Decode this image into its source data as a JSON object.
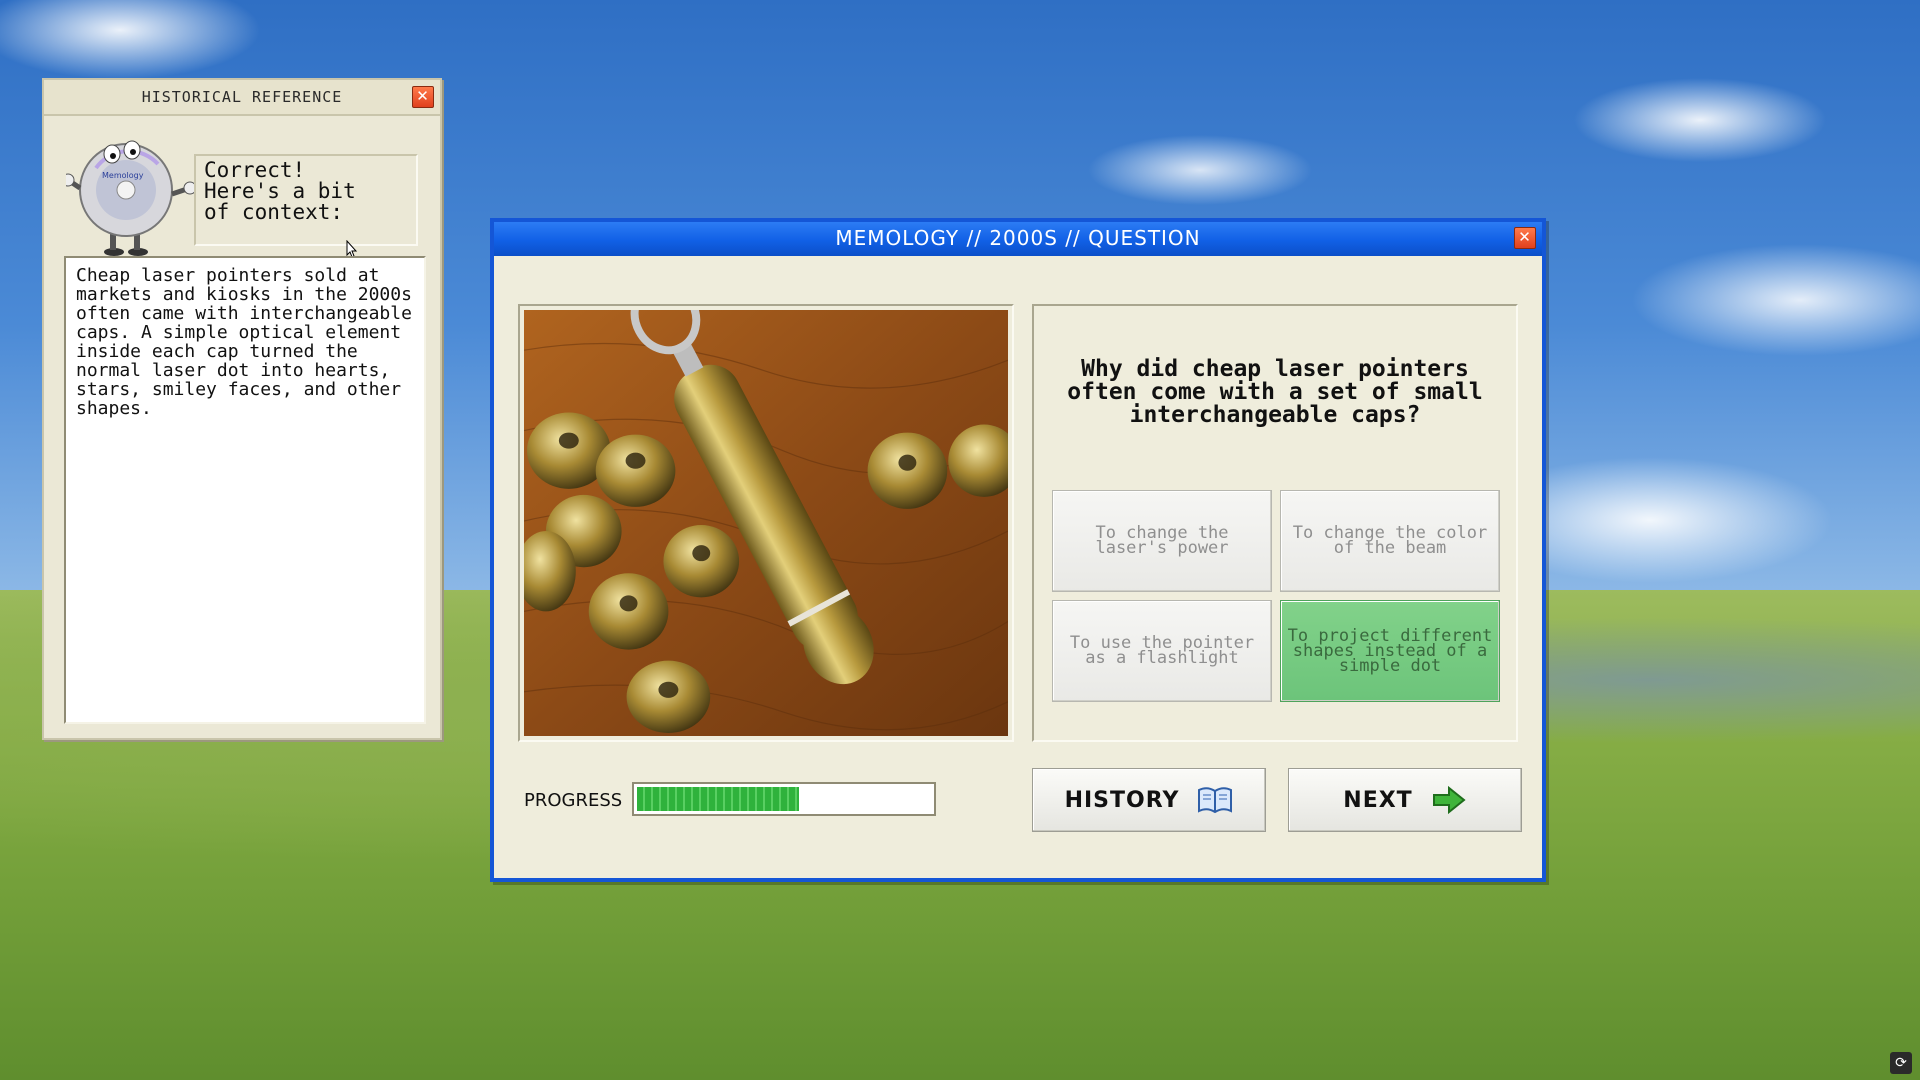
{
  "reference_window": {
    "title": "HISTORICAL REFERENCE",
    "speech": "Correct!\nHere's a bit\nof context:",
    "context_text": "Cheap laser pointers sold at markets and kiosks in the 2000s often came with interchangeable caps. A simple optical element inside each cap turned the normal laser dot into hearts, stars, smiley faces, and other shapes.",
    "mascot_icon": "cd-mascot-icon",
    "mascot_disc_label": "Memology"
  },
  "quiz_window": {
    "title": "MEMOLOGY // 2000S // QUESTION",
    "photo_icon": "laser-pointer-photo",
    "question": "Why did cheap laser pointers often come with a set of small interchangeable caps?",
    "answers": [
      {
        "label": "To change the laser's power",
        "state": "disabled"
      },
      {
        "label": "To change the color of the beam",
        "state": "disabled"
      },
      {
        "label": "To use the pointer as a flashlight",
        "state": "disabled"
      },
      {
        "label": "To project different shapes instead of a simple dot",
        "state": "correct"
      }
    ],
    "progress": {
      "label": "PROGRESS",
      "fraction": 0.55
    },
    "history_button": {
      "label": "HISTORY",
      "icon": "book-icon"
    },
    "next_button": {
      "label": "NEXT",
      "icon": "arrow-right-icon"
    }
  },
  "colors": {
    "title_blue": "#1160e6",
    "correct_green": "#6cc47a",
    "close_red": "#e0401d",
    "progress_green": "#2fb23c"
  }
}
